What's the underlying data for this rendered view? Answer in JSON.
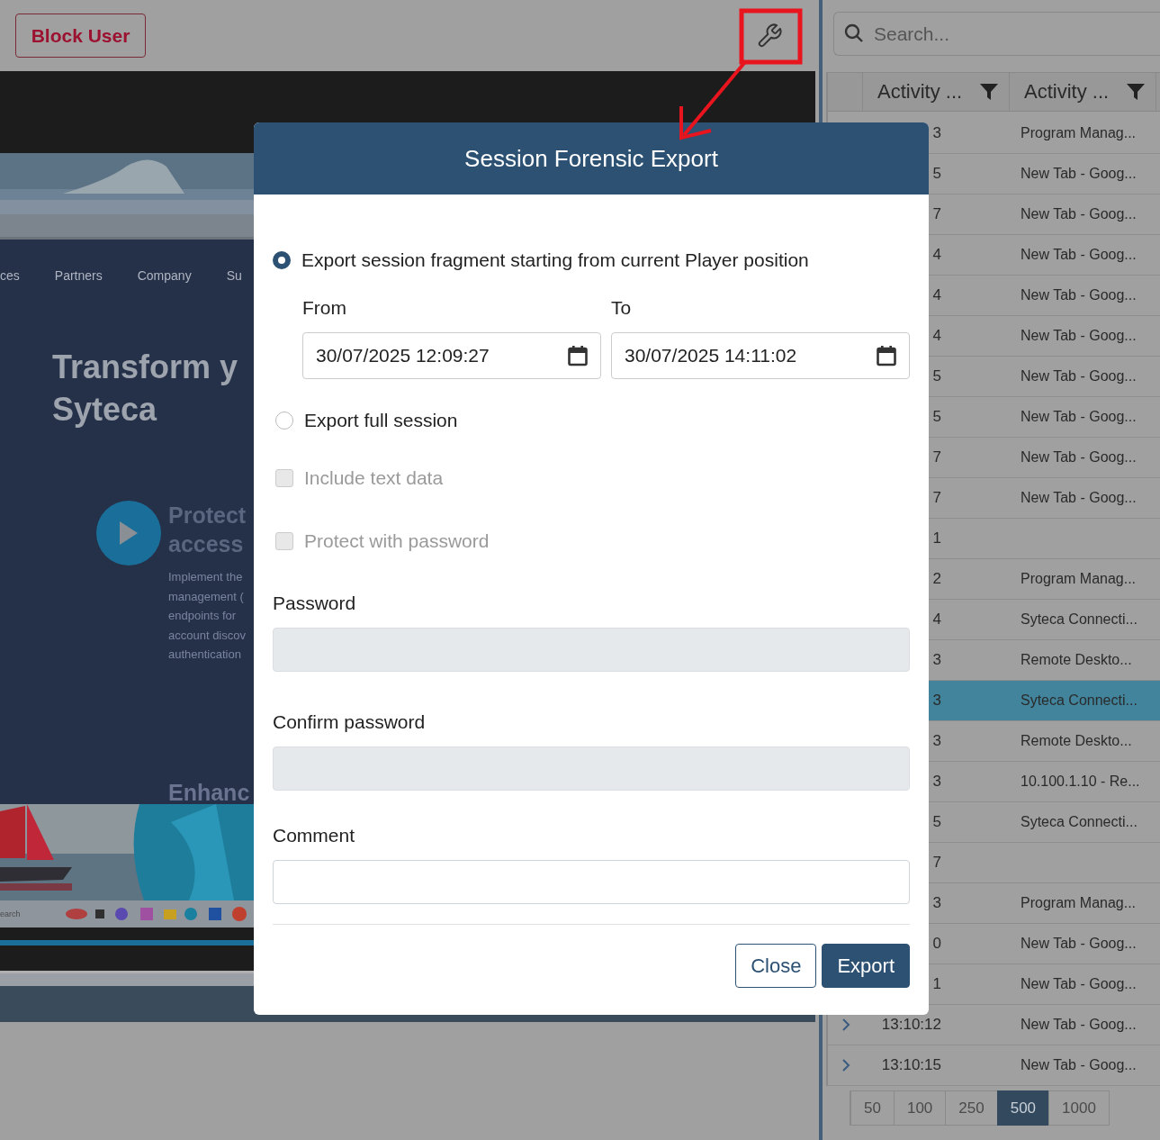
{
  "toolbar": {
    "block_button": "Block User"
  },
  "remote_screen": {
    "nav_items": [
      "ces",
      "Partners",
      "Company",
      "Su"
    ],
    "heading_lines": [
      "Transform y",
      "Syteca"
    ],
    "feature_title_lines": [
      "Protect",
      "access"
    ],
    "feature_text_lines": [
      "Implement the",
      "management (",
      "endpoints for",
      "account discov",
      "authentication"
    ],
    "next_title": "Enhanc",
    "taskbar_search": "earch"
  },
  "search": {
    "placeholder": "Search..."
  },
  "table": {
    "columns": [
      "Activity ...",
      "Activity ..."
    ],
    "rows": [
      {
        "column_1": "3",
        "title": "Program Manag...",
        "selected": false,
        "expander": false
      },
      {
        "column_1": "5",
        "title": "New Tab - Goog...",
        "selected": false,
        "expander": false
      },
      {
        "column_1": "7",
        "title": "New Tab - Goog...",
        "selected": false,
        "expander": false
      },
      {
        "column_1": "4",
        "title": "New Tab - Goog...",
        "selected": false,
        "expander": false
      },
      {
        "column_1": "4",
        "title": "New Tab - Goog...",
        "selected": false,
        "expander": false
      },
      {
        "column_1": "4",
        "title": "New Tab - Goog...",
        "selected": false,
        "expander": false
      },
      {
        "column_1": "5",
        "title": "New Tab - Goog...",
        "selected": false,
        "expander": false
      },
      {
        "column_1": "5",
        "title": "New Tab - Goog...",
        "selected": false,
        "expander": false
      },
      {
        "column_1": "7",
        "title": "New Tab - Goog...",
        "selected": false,
        "expander": false
      },
      {
        "column_1": "7",
        "title": "New Tab - Goog...",
        "selected": false,
        "expander": false
      },
      {
        "column_1": "1",
        "selected": false,
        "expander": false
      },
      {
        "column_1": "2",
        "title": "Program Manag...",
        "selected": false,
        "expander": false
      },
      {
        "column_1": "4",
        "title": "Syteca Connecti...",
        "selected": false,
        "expander": false
      },
      {
        "column_1": "3",
        "title": "Remote Deskto...",
        "selected": false,
        "expander": false
      },
      {
        "column_1": "3",
        "title": "Syteca Connecti...",
        "selected": true,
        "expander": false
      },
      {
        "column_1": "3",
        "title": "Remote Deskto...",
        "selected": false,
        "expander": false
      },
      {
        "column_1": "3",
        "title": "10.100.1.10 - Re...",
        "selected": false,
        "expander": false
      },
      {
        "column_1": "5",
        "title": "Syteca Connecti...",
        "selected": false,
        "expander": false
      },
      {
        "column_1": "7",
        "selected": false,
        "expander": false
      },
      {
        "column_1": "3",
        "title": "Program Manag...",
        "selected": false,
        "expander": false
      },
      {
        "column_1": "0",
        "title": "New Tab - Goog...",
        "selected": false,
        "expander": false
      },
      {
        "column_1": "1",
        "title": "New Tab - Goog...",
        "selected": false,
        "expander": false
      },
      {
        "column_1": "13:10:12",
        "title": "New Tab - Goog...",
        "selected": false,
        "expander": true
      },
      {
        "column_1": "13:10:15",
        "title": "New Tab - Goog...",
        "selected": false,
        "expander": true
      }
    ]
  },
  "page_sizes": [
    {
      "label": "50",
      "selected": false
    },
    {
      "label": "100",
      "selected": false
    },
    {
      "label": "250",
      "selected": false
    },
    {
      "label": "500",
      "selected": true
    },
    {
      "label": "1000",
      "selected": false
    }
  ],
  "dialog": {
    "title": "Session Forensic Export",
    "options": [
      {
        "label": "Export session fragment starting from current Player position",
        "selected": true
      },
      {
        "label": "Export full session",
        "selected": false
      }
    ],
    "range": {
      "from_label": "From",
      "from_value": "30/07/2025 12:09:27",
      "to_label": "To",
      "to_value": "30/07/2025 14:11:02"
    },
    "checkboxes": [
      {
        "label": "Include text data",
        "checked": false,
        "disabled": true
      },
      {
        "label": "Protect with password",
        "checked": false,
        "disabled": true
      }
    ],
    "fields": [
      {
        "label": "Password",
        "disabled": true
      },
      {
        "label": "Confirm password",
        "disabled": true
      },
      {
        "label": "Comment",
        "disabled": false
      }
    ],
    "buttons": [
      {
        "label": "Close",
        "kind": "secondary"
      },
      {
        "label": "Export",
        "kind": "primary"
      }
    ]
  }
}
